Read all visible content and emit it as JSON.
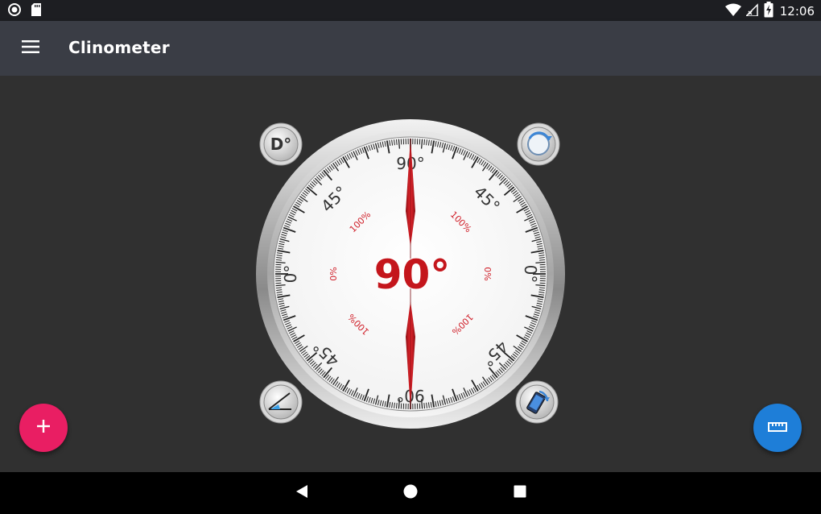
{
  "status_bar": {
    "time": "12:06",
    "icons": [
      "record-icon",
      "sd-card-icon",
      "wifi-icon",
      "no-signal-icon",
      "battery-charging-icon"
    ]
  },
  "app_bar": {
    "title": "Clinometer",
    "menu_icon": "hamburger-menu-icon"
  },
  "dial": {
    "reading": "90°",
    "top_label": "90°",
    "bottom_label": "90°",
    "upper_left_label": "45°",
    "upper_right_label": "45°",
    "lower_left_label": "45°",
    "lower_right_label": "45°",
    "left_label": "0°",
    "right_label": "0°",
    "percent_upper_left": "100%",
    "percent_upper_right": "100%",
    "percent_lower_left": "100%",
    "percent_lower_right": "100%",
    "percent_left": "0%",
    "percent_right": "0%",
    "infinity_top": "∞",
    "infinity_bottom": "∞",
    "needle_angle_deg": 90,
    "needle_color": "#d01c24",
    "reading_color": "#c4161c"
  },
  "corner_buttons": {
    "degree_mode_label": "D°",
    "calibrate_icon": "calibrate-dial-icon",
    "angle_icon": "angle-measure-icon",
    "rotate_device_icon": "rotate-phone-icon"
  },
  "fabs": {
    "add_icon": "plus-icon",
    "add_color": "#e91e63",
    "ruler_icon": "ruler-icon",
    "ruler_color": "#1e7ed8"
  },
  "nav_bar": {
    "icons": [
      "back-icon",
      "home-icon",
      "recents-icon"
    ]
  }
}
